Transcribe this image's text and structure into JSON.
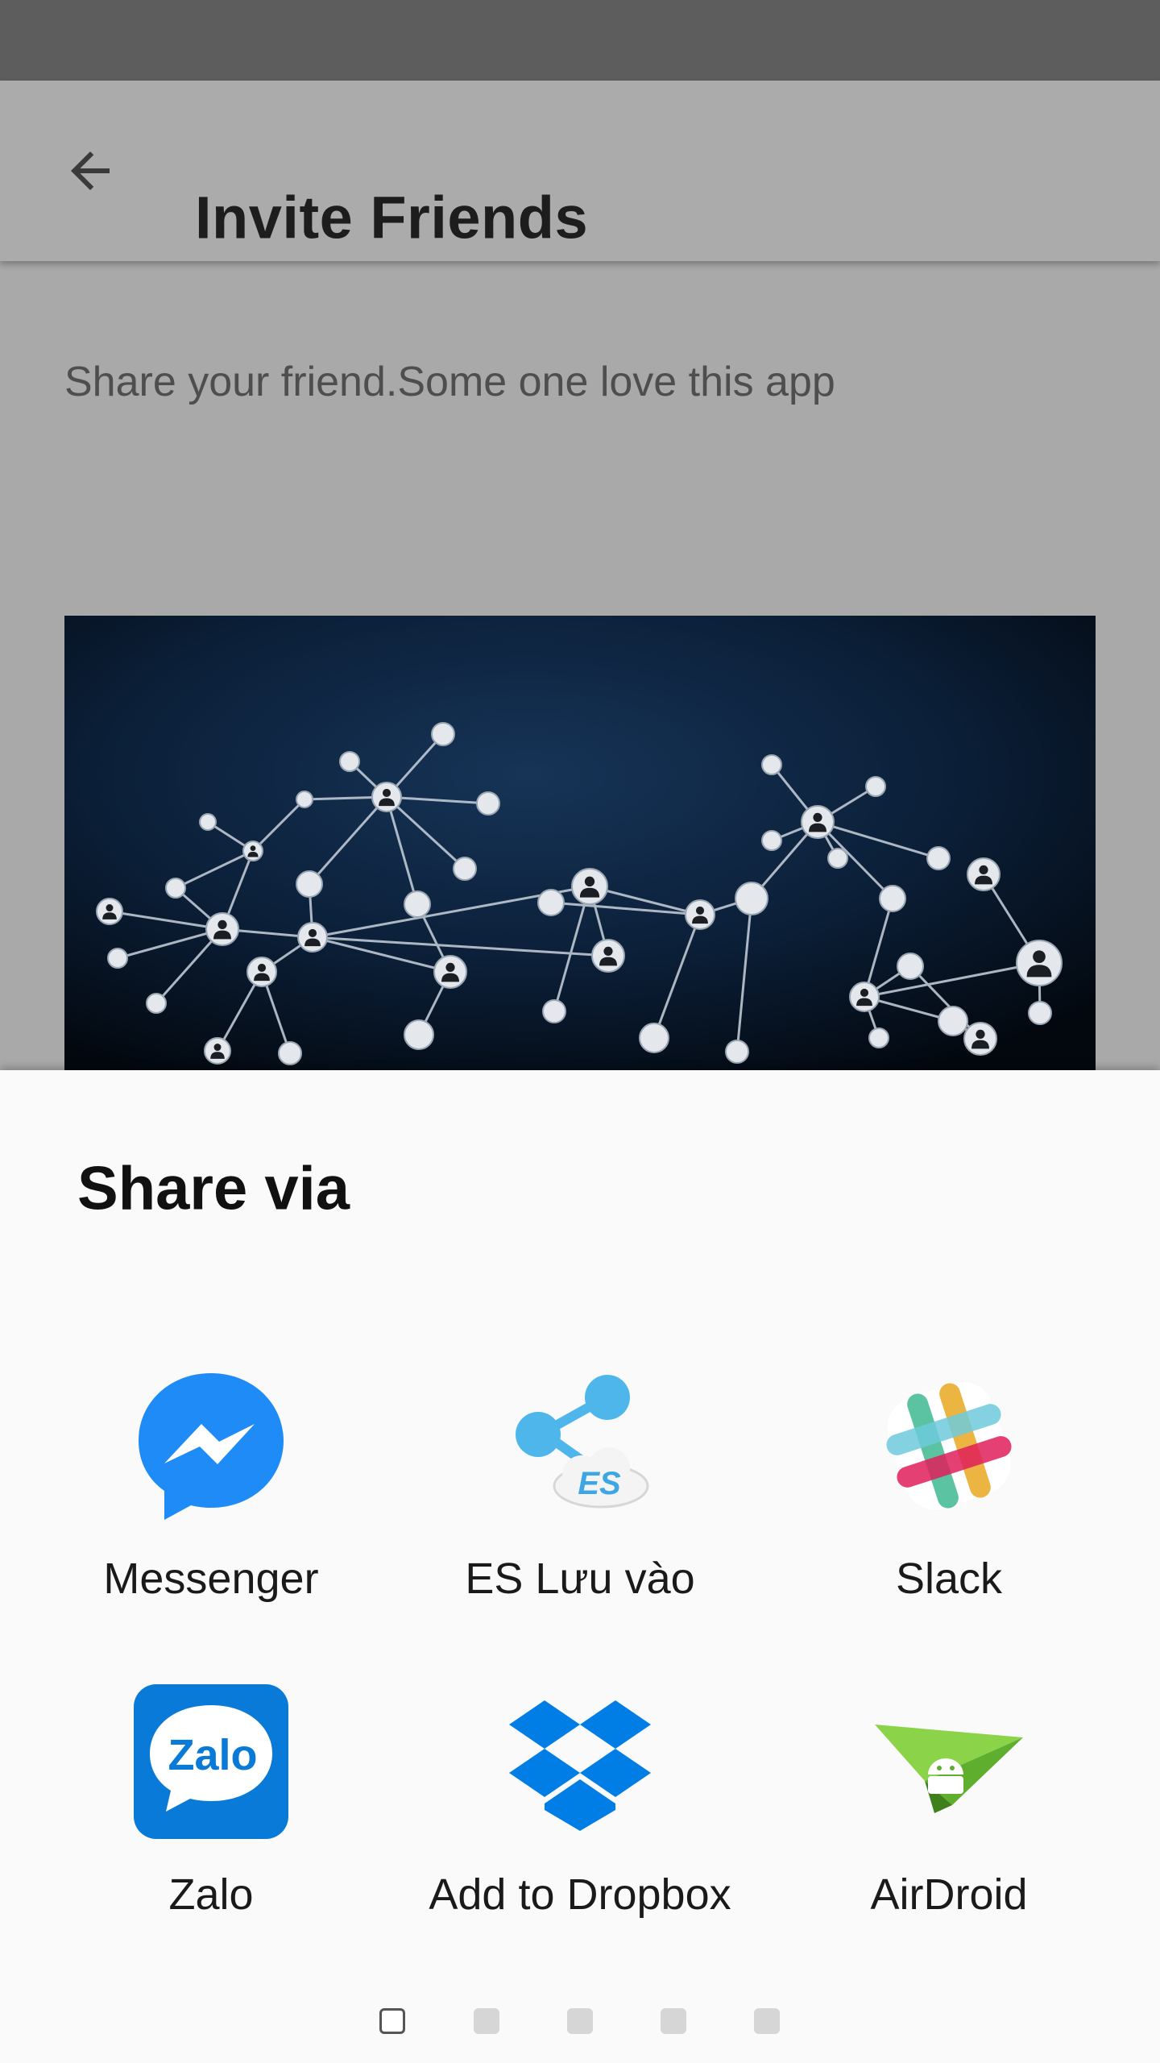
{
  "app_bar": {
    "back_icon": "arrow-left-icon",
    "title": "Invite Friends"
  },
  "content": {
    "intro_text": "Share your friend.Some one love this app",
    "image": "social-network-illustration"
  },
  "share_sheet": {
    "title": "Share via",
    "apps": [
      {
        "label": "Messenger",
        "icon": "messenger-icon",
        "color": "#1e8bf6"
      },
      {
        "label": "ES Lưu vào",
        "icon": "es-share-icon",
        "color": "#4fb6ec"
      },
      {
        "label": "Slack",
        "icon": "slack-icon",
        "color": "#e01e5a"
      },
      {
        "label": "Zalo",
        "icon": "zalo-icon",
        "color": "#0a7ad8"
      },
      {
        "label": "Add to Dropbox",
        "icon": "dropbox-icon",
        "color": "#007ee5"
      },
      {
        "label": "AirDroid",
        "icon": "airdroid-icon",
        "color": "#7ac943"
      }
    ],
    "pages": 5,
    "current_page": 1
  },
  "colors": {
    "status_bar": "#5d5d5d",
    "app_bar": "#ababab",
    "scrim_content": "#a9a9a9",
    "sheet_background": "#fafafa"
  }
}
